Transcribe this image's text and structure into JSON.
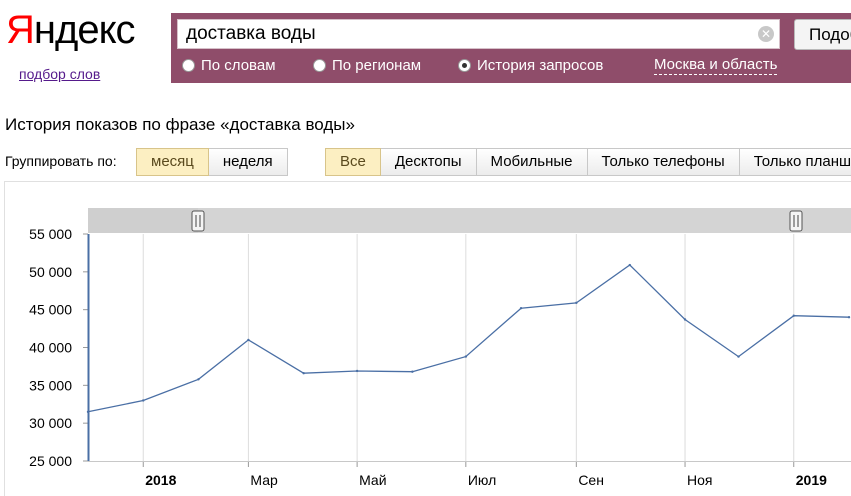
{
  "header": {
    "logo_first": "Я",
    "logo_rest": "ндекс",
    "wordstat_link": "подбор слов"
  },
  "search": {
    "query": "доставка воды",
    "clear_icon": "close-icon",
    "button_label": "Подобрать",
    "modes": [
      {
        "label": "По словам",
        "selected": false
      },
      {
        "label": "По регионам",
        "selected": false
      },
      {
        "label": "История запросов",
        "selected": true
      }
    ],
    "region": "Москва и область"
  },
  "main": {
    "title": "История показов по фразе «доставка воды»",
    "group_by_label": "Группировать по:",
    "group_buttons": [
      {
        "label": "месяц",
        "active": true
      },
      {
        "label": "неделя",
        "active": false
      }
    ],
    "device_tabs": [
      {
        "label": "Все",
        "active": true
      },
      {
        "label": "Десктопы",
        "active": false
      },
      {
        "label": "Мобильные",
        "active": false
      },
      {
        "label": "Только телефоны",
        "active": false
      },
      {
        "label": "Только планшеты",
        "active": false
      }
    ]
  },
  "colors": {
    "searchbar_bg": "#8f4d6a",
    "line": "#4a6fa5",
    "active_button": "#fcefc2"
  },
  "chart_data": {
    "type": "line",
    "series": [
      {
        "x": [
          "2017-12-01",
          "2018-01-01",
          "2018-02-01",
          "2018-03-01",
          "2018-04-01",
          "2018-05-01",
          "2018-06-01",
          "2018-07-01",
          "2018-08-01",
          "2018-09-01",
          "2018-10-01",
          "2018-11-01",
          "2018-12-01",
          "2019-01-01",
          "2019-02-01"
        ],
        "values": [
          31500,
          33000,
          35800,
          41000,
          36600,
          36900,
          36800,
          38800,
          45200,
          45900,
          50900,
          43700,
          38800,
          44200,
          44000
        ]
      }
    ],
    "y_ticks": [
      "25 000",
      "30 000",
      "35 000",
      "40 000",
      "45 000",
      "50 000",
      "55 000"
    ],
    "ylim": [
      25000,
      55000
    ],
    "x_tick_labels": [
      {
        "date": "2018-01-01",
        "label": "2018",
        "bold": true
      },
      {
        "date": "2018-03-01",
        "label": "Мар",
        "bold": false
      },
      {
        "date": "2018-05-01",
        "label": "Май",
        "bold": false
      },
      {
        "date": "2018-07-01",
        "label": "Июл",
        "bold": false
      },
      {
        "date": "2018-09-01",
        "label": "Сен",
        "bold": false
      },
      {
        "date": "2018-11-01",
        "label": "Ноя",
        "bold": false
      },
      {
        "date": "2019-01-01",
        "label": "2019",
        "bold": true
      }
    ],
    "xlim": [
      "2017-12-01",
      "2019-02-01"
    ],
    "grid": true
  }
}
